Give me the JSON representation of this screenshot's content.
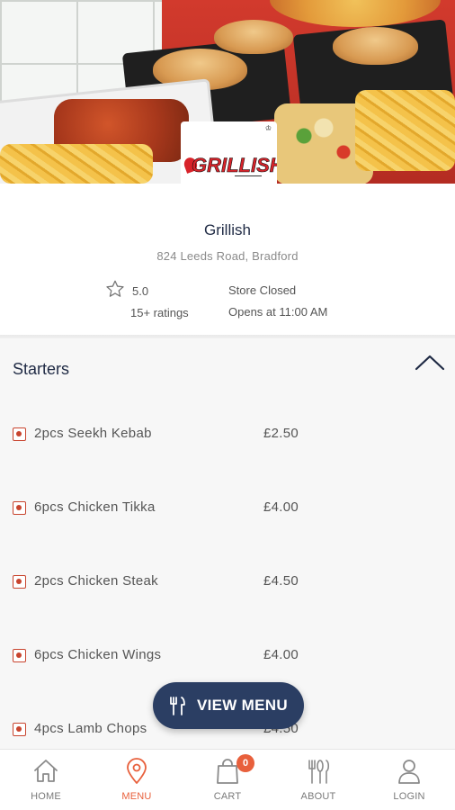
{
  "store": {
    "name": "Grillish",
    "address": "824 Leeds Road, Bradford",
    "rating": "5.0",
    "rating_count": "15+ ratings",
    "status": "Store Closed",
    "opens": "Opens at 11:00 AM"
  },
  "logo": {
    "brand_text": "GRILLISH"
  },
  "menu": {
    "section_title": "Starters",
    "items": [
      {
        "name": "2pcs Seekh Kebab",
        "price": "£2.50"
      },
      {
        "name": "6pcs Chicken Tikka",
        "price": "£4.00"
      },
      {
        "name": "2pcs Chicken Steak",
        "price": "£4.50"
      },
      {
        "name": "6pcs Chicken Wings",
        "price": "£4.00"
      },
      {
        "name": "4pcs Lamb Chops",
        "price": "£4.50"
      }
    ]
  },
  "view_menu_button": {
    "label": "VIEW MENU"
  },
  "bottom_nav": {
    "items": [
      {
        "label": "HOME",
        "icon": "home-icon"
      },
      {
        "label": "MENU",
        "icon": "location-pin-icon",
        "active": true
      },
      {
        "label": "CART",
        "icon": "shopping-bag-icon",
        "badge": "0"
      },
      {
        "label": "ABOUT",
        "icon": "cutlery-icon"
      },
      {
        "label": "LOGIN",
        "icon": "user-icon"
      }
    ]
  },
  "colors": {
    "accent": "#e8603c",
    "button": "#2b3e63",
    "title": "#1f2a44",
    "brand_red": "#d8232a"
  }
}
